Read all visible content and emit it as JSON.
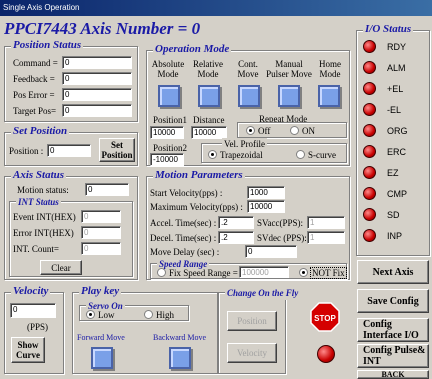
{
  "window": {
    "title": "Single Axis Operation"
  },
  "header": {
    "heading": "PPCI7443  Axis Number = 0"
  },
  "position_status": {
    "title": "Position Status",
    "rows": [
      {
        "label": "Command =",
        "value": "0"
      },
      {
        "label": "Feedback =",
        "value": "0"
      },
      {
        "label": "Pos Error =",
        "value": "0"
      },
      {
        "label": "Target Pos=",
        "value": "0"
      }
    ]
  },
  "set_position": {
    "title": "Set Position",
    "label": "Position :",
    "value": "0",
    "button": "Set Position"
  },
  "axis_status": {
    "title": "Axis Status",
    "motion_label": "Motion status:",
    "motion_value": "0",
    "int_status": {
      "title": "INT Status",
      "rows": [
        {
          "label": "Event INT(HEX)",
          "value": "0"
        },
        {
          "label": "Error INT(HEX)",
          "value": "0"
        },
        {
          "label": "INT. Count=",
          "value": "0"
        }
      ]
    },
    "clear_button": "Clear"
  },
  "operation_mode": {
    "title": "Operation Mode",
    "modes": [
      {
        "label": "Absolute Mode"
      },
      {
        "label": "Relative Mode"
      },
      {
        "label": "Cont. Move"
      },
      {
        "label": "Manual Pulser Move"
      },
      {
        "label": "Home Mode"
      }
    ],
    "position1_label": "Position1",
    "position1_value": "10000",
    "distance_label": "Distance",
    "distance_value": "10000",
    "position2_label": "Position2",
    "position2_value": "-10000",
    "repeat_mode": {
      "title": "Repeat Mode",
      "options": [
        "Off",
        "ON"
      ],
      "selected": "Off"
    },
    "vel_profile": {
      "title": "Vel. Profile",
      "options": [
        "Trapezoidal",
        "S-curve"
      ],
      "selected": "Trapezoidal"
    }
  },
  "motion_parameters": {
    "title": "Motion Parameters",
    "start_velocity_label": "Start Velocity(pps) :",
    "start_velocity": "1000",
    "max_velocity_label": "Maximum Velocity(pps) :",
    "max_velocity": "10000",
    "accel_label": "Accel. Time(sec) :",
    "accel": ".2",
    "svacc_label": "SVacc(PPS):",
    "svacc": "1",
    "decel_label": "Decel. Time(sec) :",
    "decel": ".2",
    "svdec_label": "SVdec (PPS):",
    "svdec": "1",
    "move_delay_label": "Move Delay (sec) :",
    "move_delay": "0",
    "speed_range": {
      "title": "Speed Range",
      "fix_label": "Fix Speed Range =",
      "fix_value": "100000",
      "not_fix_label": "NOT Fix",
      "selected": "NOT Fix"
    }
  },
  "velocity": {
    "title": "Velocity",
    "value": "0",
    "unit": "(PPS)",
    "show_curve": "Show Curve"
  },
  "play_key": {
    "title": "Play key",
    "servo_on": {
      "title": "Servo On",
      "options": [
        "Low",
        "High"
      ],
      "selected": "Low"
    },
    "forward_label": "Forward Move",
    "backward_label": "Backward Move"
  },
  "change_on_fly": {
    "title": "Change On the Fly",
    "position_button": "Position",
    "velocity_button": "Velocity"
  },
  "stop_button": "STOP",
  "io_status": {
    "title": "I/O Status",
    "items": [
      {
        "label": "RDY",
        "state": "red"
      },
      {
        "label": "ALM",
        "state": "red"
      },
      {
        "label": "+EL",
        "state": "red"
      },
      {
        "label": "-EL",
        "state": "red"
      },
      {
        "label": "ORG",
        "state": "red"
      },
      {
        "label": "ERC",
        "state": "red"
      },
      {
        "label": "EZ",
        "state": "red"
      },
      {
        "label": "CMP",
        "state": "red"
      },
      {
        "label": "SD",
        "state": "red"
      },
      {
        "label": "INP",
        "state": "red"
      }
    ]
  },
  "side_buttons": {
    "next_axis": "Next Axis",
    "save_config": "Save Config",
    "config_io": "Config Interface I/O",
    "config_pulse": "Config Pulse& INT",
    "back": "BACK"
  },
  "colors": {
    "led_red": "#c80000",
    "title_blue": "#1a1aa6",
    "mode_button": "#7aa0e8",
    "stop_red": "#d40000"
  }
}
